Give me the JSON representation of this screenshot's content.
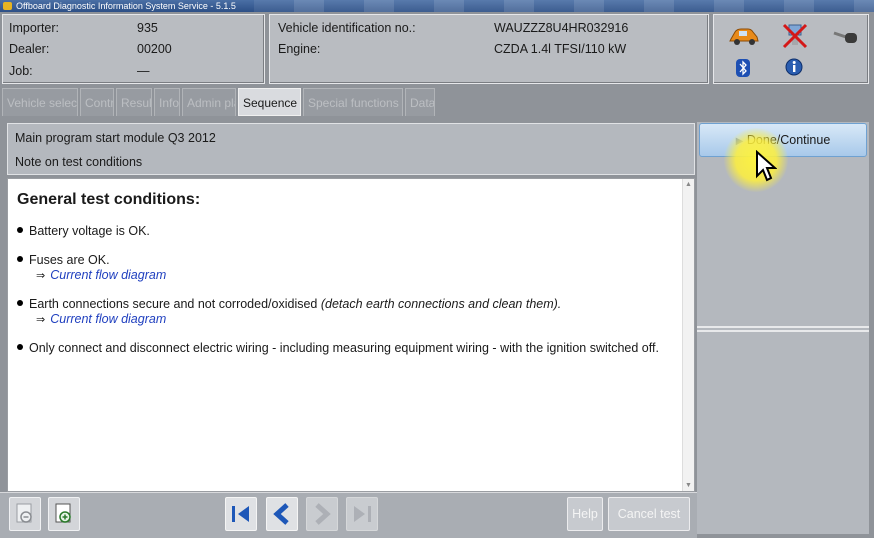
{
  "window": {
    "title": "Offboard Diagnostic Information System Service - 5.1.5"
  },
  "info": {
    "importer_label": "Importer:",
    "importer_value": "935",
    "dealer_label": "Dealer:",
    "dealer_value": "00200",
    "job_label": "Job:",
    "job_value": "—",
    "vin_label": "Vehicle identification no.:",
    "vin_value": "WAUZZZ8U4HR032916",
    "engine_label": "Engine:",
    "engine_value": "CZDA 1.4l TFSI/110 kW"
  },
  "icons": [
    "car-icon",
    "disconnected-plug-icon",
    "key-icon",
    "bluetooth-icon",
    "info-icon"
  ],
  "tabs": [
    {
      "label": "Vehicle selection",
      "active": false
    },
    {
      "label": "Control",
      "active": false
    },
    {
      "label": "Results",
      "active": false
    },
    {
      "label": "Info",
      "active": false
    },
    {
      "label": "Admin plan",
      "active": false
    },
    {
      "label": "Sequence",
      "active": true
    },
    {
      "label": "Special functions",
      "active": false
    },
    {
      "label": "Data",
      "active": false
    }
  ],
  "header": {
    "program": "Main program start module Q3 2012",
    "note": "Note on test conditions"
  },
  "content": {
    "heading": "General test conditions:",
    "items": [
      {
        "text": "Battery voltage is OK."
      },
      {
        "text": "Fuses are OK.",
        "link": "Current flow diagram"
      },
      {
        "text": "Earth connections secure and not corroded/oxidised",
        "italic": "(detach earth connections and clean them).",
        "link": "Current flow diagram"
      },
      {
        "text": "Only connect and disconnect electric wiring - including measuring equipment wiring - with the ignition switched off."
      }
    ]
  },
  "actions": {
    "done_label": "Done/Continue",
    "help_label": "Help",
    "cancel_label": "Cancel test"
  },
  "colors": {
    "accent_link": "#1f3fbf",
    "done_button": "#a8c9ea",
    "highlight": "#fff03c"
  }
}
